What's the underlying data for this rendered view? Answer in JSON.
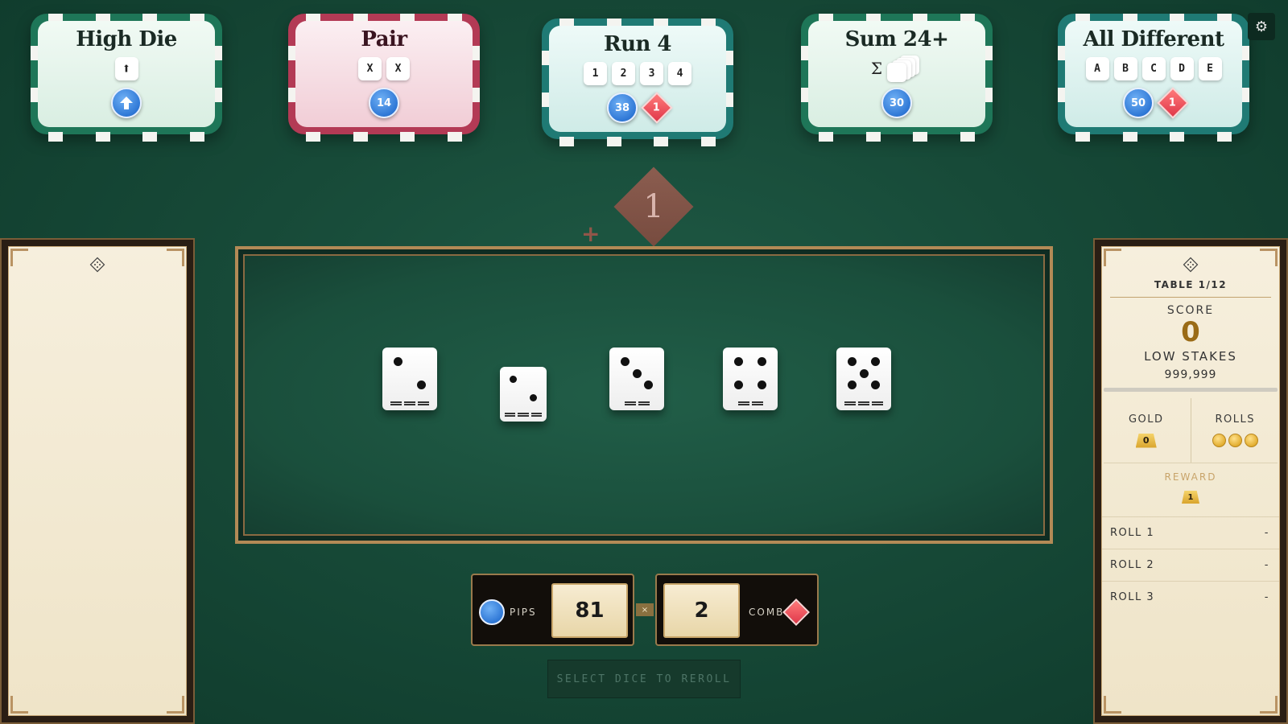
{
  "combos": [
    {
      "title": "High Die",
      "theme": "green",
      "glyphs": [],
      "glyph_icon": "arrow-up",
      "pips": "",
      "combo": ""
    },
    {
      "title": "Pair",
      "theme": "red",
      "glyphs": [
        "X",
        "X"
      ],
      "pips": "14",
      "combo": ""
    },
    {
      "title": "Run 4",
      "theme": "teal",
      "glyphs": [
        "1",
        "2",
        "3",
        "4"
      ],
      "pips": "38",
      "combo": "1"
    },
    {
      "title": "Sum 24+",
      "theme": "green",
      "glyphs": [],
      "glyph_icon": "sigma-stack",
      "sigma": "Σ",
      "pips": "30",
      "combo": ""
    },
    {
      "title": "All Different",
      "theme": "teal",
      "glyphs": [
        "A",
        "B",
        "C",
        "D",
        "E"
      ],
      "pips": "50",
      "combo": "1"
    }
  ],
  "floating_combo": {
    "value": "1",
    "plus": "+"
  },
  "dice": [
    2,
    2,
    3,
    4,
    5
  ],
  "score_bar": {
    "pips_label": "PIPS",
    "pips_value": "81",
    "times": "×",
    "combo_label": "COMBO",
    "combo_value": "2"
  },
  "reroll_button": "SELECT DICE TO REROLL",
  "right_panel": {
    "table": "TABLE 1/12",
    "score_label": "SCORE",
    "score_value": "0",
    "stakes_label": "LOW STAKES",
    "stakes_value": "999,999",
    "gold_label": "GOLD",
    "gold_value": "0",
    "rolls_label": "ROLLS",
    "rolls_remaining": 3,
    "reward_label": "REWARD",
    "reward_value": "1",
    "rolls": [
      {
        "label": "ROLL 1",
        "value": "-"
      },
      {
        "label": "ROLL 2",
        "value": "-"
      },
      {
        "label": "ROLL 3",
        "value": "-"
      }
    ]
  },
  "colors": {
    "felt": "#1a4f3c",
    "pips_blue": "#2f78d6",
    "combo_red": "#e0384a",
    "gold": "#9a6b16"
  }
}
